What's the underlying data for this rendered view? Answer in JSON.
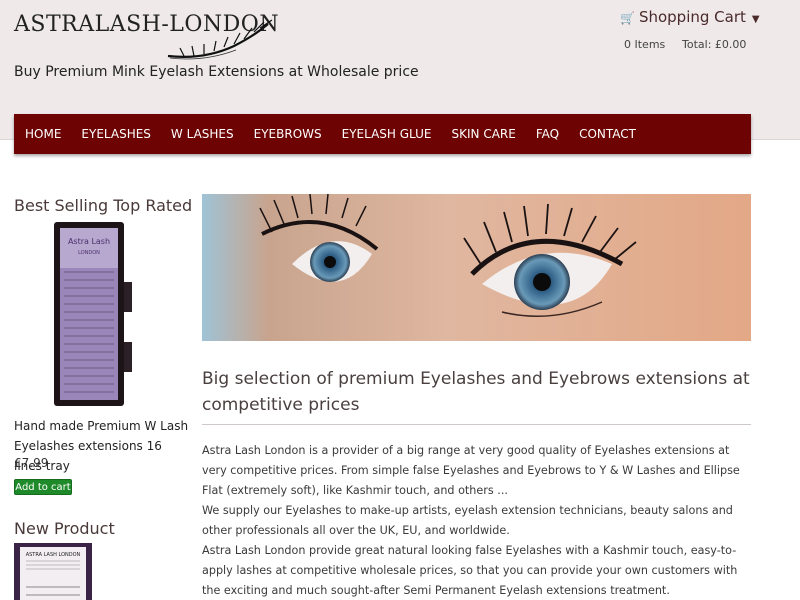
{
  "header": {
    "logo_text": "ASTRALASH-LONDON",
    "tagline": "Buy Premium Mink Eyelash Extensions at Wholesale price"
  },
  "cart": {
    "title": "Shopping Cart",
    "items": "0 Items",
    "total": "Total: £0.00"
  },
  "nav": {
    "items": [
      "HOME",
      "EYELASHES",
      "W LASHES",
      "EYEBROWS",
      "EYELASH GLUE",
      "SKIN CARE",
      "FAQ",
      "CONTACT"
    ]
  },
  "sidebar": {
    "best_selling": {
      "title": "Best Selling Top Rated",
      "product_brand": "Astra Lash",
      "product_brand_sub": "LONDON",
      "product_name": "Hand made Premium W Lash Eyelashes extensions 16 lines tray",
      "price": "£7.99",
      "add_to_cart": "Add to cart"
    },
    "new_product": {
      "title": "New Product",
      "product_brand": "ASTRA LASH LONDON"
    }
  },
  "main": {
    "heading": "Big selection of premium Eyelashes and Eyebrows extensions at competitive prices",
    "paragraphs": [
      "Astra Lash London is a provider of a big range at very good quality of Eyelashes extensions at very competitive prices. From simple false Eyelashes and Eyebrows to Y & W Lashes and Ellipse Flat (extremely soft), like Kashmir touch, and others ...",
      "We supply our Eyelashes to make-up artists, eyelash extension technicians, beauty salons and other professionals all over the UK, EU, and worldwide.",
      "Astra Lash London provide great natural looking false Eyelashes with a Kashmir touch, easy-to-apply lashes at competitive wholesale prices, so that you can provide your own customers with the exciting and much sought-after Semi Permanent Eyelash extensions treatment."
    ]
  },
  "colors": {
    "nav_bg": "#6e0304",
    "header_bg": "#efe9ea",
    "button_green": "#1f8a2a"
  }
}
